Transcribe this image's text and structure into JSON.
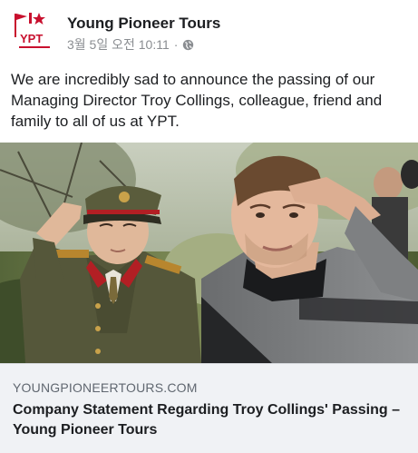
{
  "post": {
    "page_name": "Young Pioneer Tours",
    "timestamp": "3월 5일 오전 10:11",
    "separator": "·",
    "privacy_icon": "globe-icon",
    "logo_text": "YPT",
    "text": "We are incredibly sad to announce the passing of our Managing Director Troy Collings, colleague, friend and family to all of us at YPT."
  },
  "link_preview": {
    "domain": "YOUNGPIONEERTOURS.COM",
    "title": "Company Statement Regarding Troy Collings' Passing – Young Pioneer Tours"
  },
  "colors": {
    "logo_red": "#c8102e",
    "meta_gray": "#8a8d91",
    "preview_bg": "#f0f2f5"
  }
}
